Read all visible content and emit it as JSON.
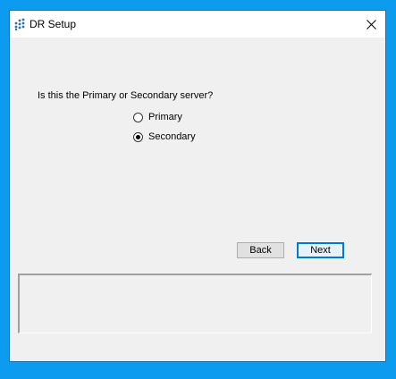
{
  "window": {
    "title": "DR Setup",
    "close_icon": "close-icon",
    "app_icon": "dots-grid-icon"
  },
  "main": {
    "question": "Is this the Primary or Secondary server?",
    "options": [
      {
        "label": "Primary",
        "selected": false
      },
      {
        "label": "Secondary",
        "selected": true
      }
    ],
    "back_label": "Back",
    "next_label": "Next",
    "log_text": ""
  },
  "colors": {
    "desktop": "#0d9bf0",
    "window_bg": "#f0f0f0",
    "accent": "#0078d7",
    "icon_blue": "#2a6fb8"
  }
}
